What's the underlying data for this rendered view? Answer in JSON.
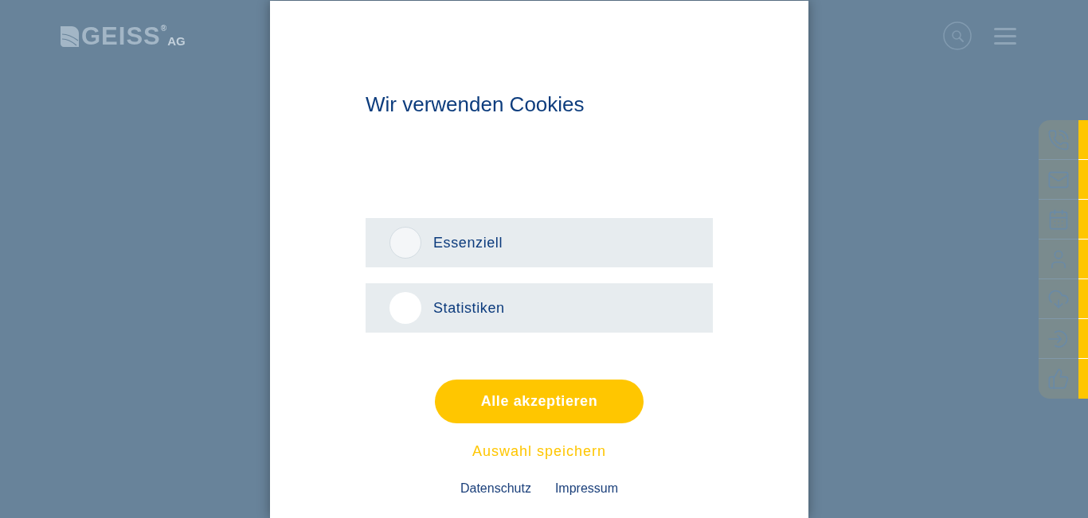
{
  "header": {
    "logo": {
      "name": "GEISS",
      "mark": "®",
      "suffix": "AG"
    },
    "actions": [
      {
        "kind": "search"
      },
      {
        "kind": "menu"
      }
    ]
  },
  "side_toolbar": {
    "items": [
      {
        "kind": "phone"
      },
      {
        "kind": "mail"
      },
      {
        "kind": "calendar"
      },
      {
        "kind": "user"
      },
      {
        "kind": "download"
      },
      {
        "kind": "login"
      },
      {
        "kind": "like"
      }
    ]
  },
  "dialog": {
    "title": "Wir verwenden Cookies",
    "options": [
      {
        "label": "Essenziell",
        "checked": false,
        "disabled": true
      },
      {
        "label": "Statistiken",
        "checked": false,
        "disabled": false
      }
    ],
    "primary_button": "Alle akzeptieren",
    "secondary_link": "Auswahl speichern",
    "footer_links": [
      "Datenschutz",
      "Impressum"
    ]
  }
}
